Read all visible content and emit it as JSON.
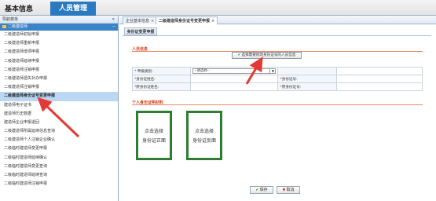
{
  "topbar": {
    "basic_info": "基本信息",
    "personnel_mgmt": "人员管理"
  },
  "sidebar": {
    "header": "导航菜单",
    "collapse": "«",
    "group": "二级建造师",
    "group_toggle": "−",
    "items": [
      {
        "label": "二级建造师初始申报",
        "active": false
      },
      {
        "label": "二级建造师重新申报",
        "active": false
      },
      {
        "label": "二级建造师增项申报",
        "active": false
      },
      {
        "label": "二级建造师延续申报",
        "active": false
      },
      {
        "label": "二级建造师注销申报",
        "active": false
      },
      {
        "label": "二级建造师遗失补办申报",
        "active": false
      },
      {
        "label": "二级建造师注销申报",
        "active": false
      },
      {
        "label": "二级建造师身份证号变更申报",
        "active": true
      },
      {
        "label": "建造师电子证书",
        "active": false
      },
      {
        "label": "建造师历史数据",
        "active": false
      },
      {
        "label": "建造师企业申报退回",
        "active": false
      },
      {
        "label": "二级建造师所属延续信息查询",
        "active": false
      },
      {
        "label": "二级建造师个人注销企业确认",
        "active": false
      },
      {
        "label": "二级临时建造师变更申报",
        "active": false
      },
      {
        "label": "二级临时建造师延续确认",
        "active": false
      },
      {
        "label": "二级临时建造师变更查询",
        "active": false
      },
      {
        "label": "二级临时建造师延续查询",
        "active": false
      },
      {
        "label": "二级临时建造师注销申报",
        "active": false
      }
    ]
  },
  "tabs": [
    {
      "label": "企业基本信息",
      "close": "×",
      "active": false
    },
    {
      "label": "二级建造师身份证号变更申报",
      "close": "×",
      "active": true
    }
  ],
  "subtab": "身份证变更申报",
  "section1": {
    "title": "人员信息",
    "select_button": "选择需要修改身份证号的人员信息"
  },
  "form": {
    "rows": [
      {
        "label1": "申报类别:",
        "req1": "*",
        "value1": "--请选择--",
        "label2": "",
        "req2": "",
        "value2": ""
      },
      {
        "label1": "身份证姓名:",
        "req1": "*",
        "value1": "",
        "label2": "身份证号:",
        "req2": "*",
        "value2": ""
      },
      {
        "label1": "原身份证姓名:",
        "req1": "*",
        "value1": "",
        "label2": "原身份证号:",
        "req2": "*",
        "value2": ""
      }
    ]
  },
  "section2": {
    "title": "个人身份证明材料"
  },
  "uploads": [
    {
      "line1": "点击选择",
      "line2": "身份证正面"
    },
    {
      "line1": "点击选择",
      "line2": "身份证反面"
    }
  ],
  "buttons": {
    "save": "保存",
    "save_icon": "✔",
    "cancel": "取消",
    "cancel_icon": "✖"
  },
  "colors": {
    "accent": "#2b79c1",
    "active_menu": "#bcd7f3",
    "upload_border": "#2e7d32",
    "arrow": "#e53935"
  }
}
